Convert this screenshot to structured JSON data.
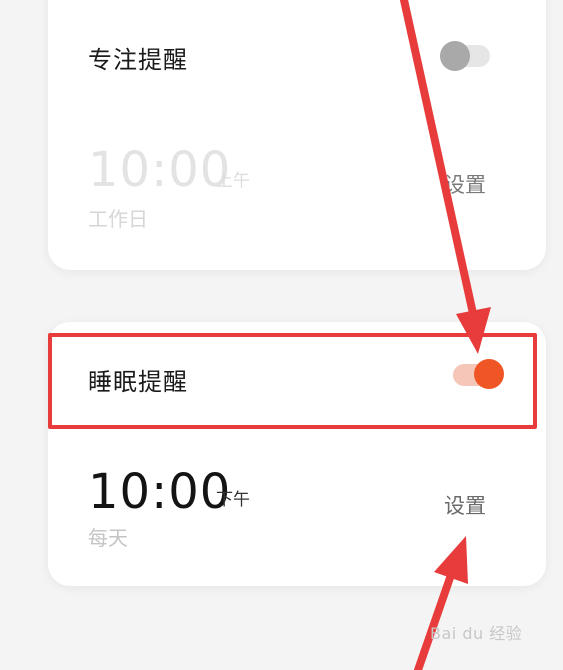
{
  "focus_card": {
    "title": "专注提醒",
    "enabled": false,
    "time": "10:00",
    "ampm": "上午",
    "days": "工作日",
    "set_label": "设置"
  },
  "sleep_card": {
    "title": "睡眠提醒",
    "enabled": true,
    "time": "10:00",
    "ampm": "下午",
    "days": "每天",
    "set_label": "设置"
  },
  "watermark": "Bai du 经验",
  "colors": {
    "accent": "#f05526",
    "annotation_red": "#e83c3c"
  }
}
